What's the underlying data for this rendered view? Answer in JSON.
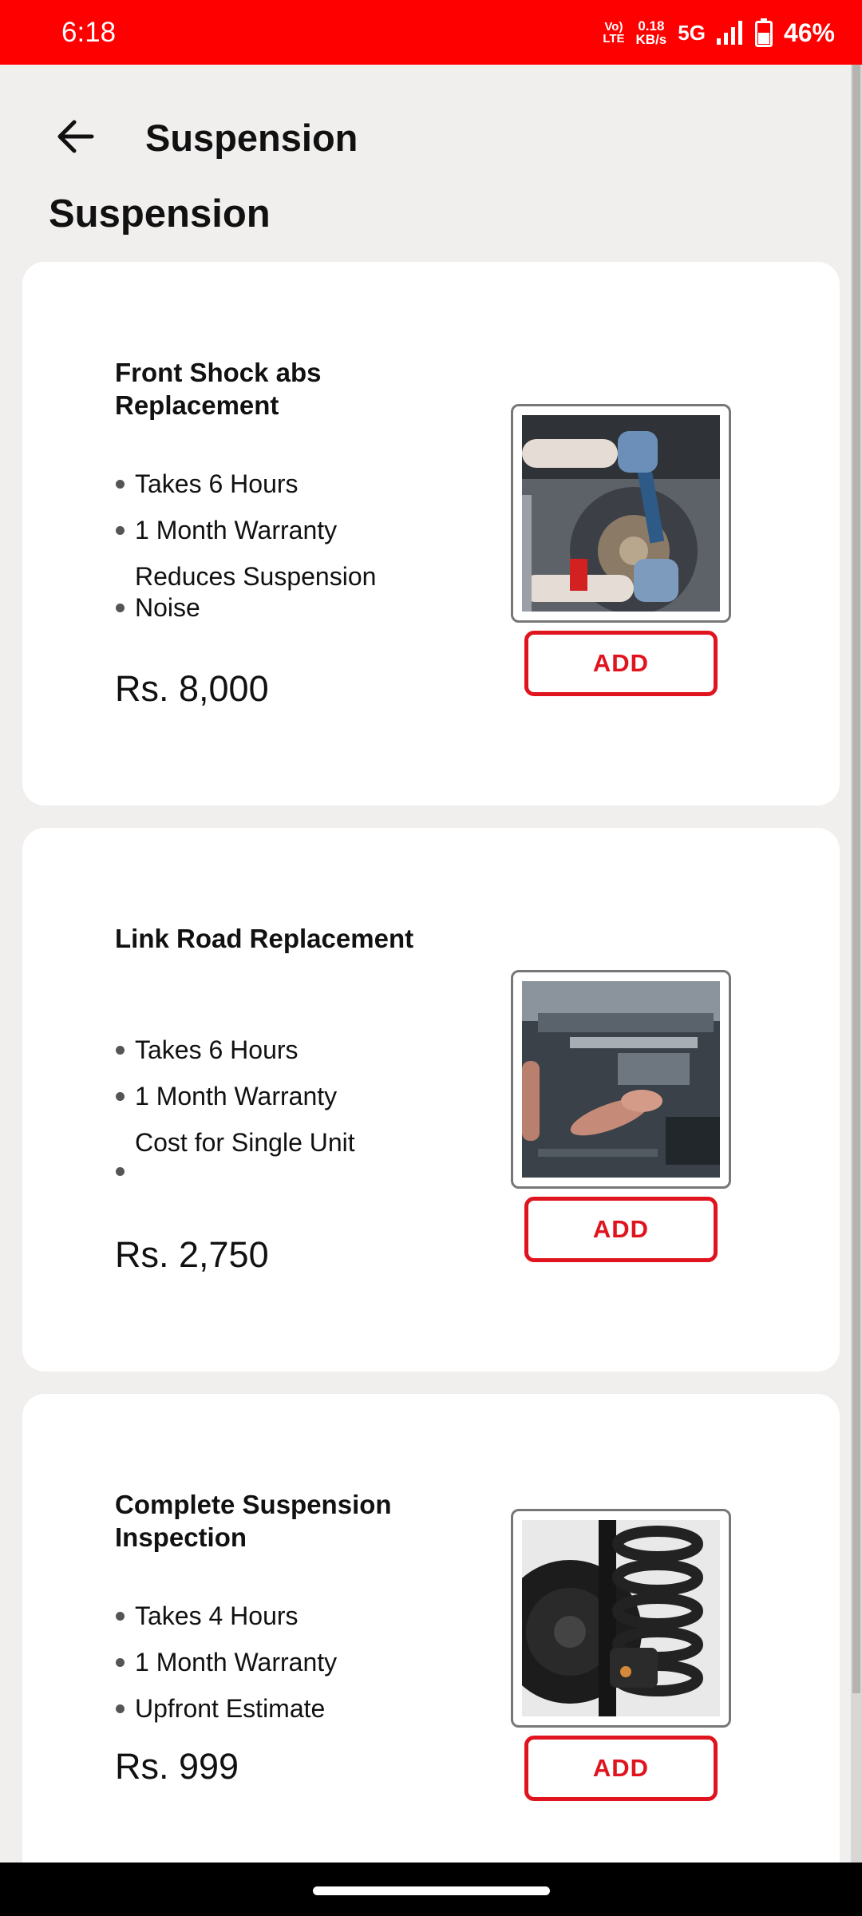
{
  "status_bar": {
    "time": "6:18",
    "volte_top": "Vo)",
    "volte_bottom": "LTE",
    "speed_value": "0.18",
    "speed_unit": "KB/s",
    "network": "5G",
    "battery": "46%",
    "icons": [
      "signal-icon",
      "battery-icon"
    ]
  },
  "header": {
    "back_icon": "arrow-left-icon",
    "title": "Suspension"
  },
  "section": {
    "title": "Suspension"
  },
  "services": [
    {
      "name": "Front Shock abs Replacement",
      "features": [
        "Takes 6 Hours",
        "1 Month Warranty",
        "Reduces Suspension Noise"
      ],
      "price": "Rs. 8,000",
      "add_label": "ADD",
      "image_icon": "shock-absorber-photo"
    },
    {
      "name": "Link Road Replacement",
      "features": [
        "Takes 6 Hours",
        "1 Month Warranty",
        "Cost for Single Unit"
      ],
      "price": "Rs. 2,750",
      "add_label": "ADD",
      "image_icon": "under-car-repair-photo"
    },
    {
      "name": "Complete Suspension Inspection",
      "features": [
        "Takes 4 Hours",
        "1 Month Warranty",
        "Upfront Estimate"
      ],
      "price": "Rs. 999",
      "add_label": "ADD",
      "image_icon": "coil-spring-photo"
    }
  ],
  "colors": {
    "status_bar": "#fe0000",
    "accent": "#e0141e",
    "background": "#f1efee",
    "card": "#ffffff"
  }
}
